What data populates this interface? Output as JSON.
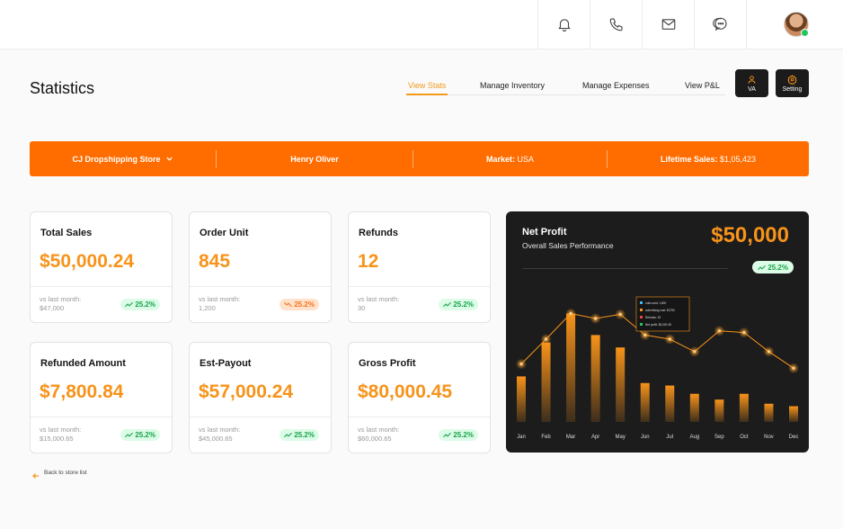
{
  "header": {
    "icons": [
      "bell-icon",
      "phone-icon",
      "mail-icon",
      "chat-icon"
    ]
  },
  "page": {
    "title": "Statistics"
  },
  "nav": {
    "view_stats": "View Stats",
    "manage_inventory": "Manage Inventory",
    "manage_expenses": "Manage Expenses",
    "view_pl": "View P&L",
    "va_label": "VA",
    "setting_label": "Setting",
    "active": "View Stats"
  },
  "banner": {
    "store": "CJ Dropshipping Store",
    "owner": "Henry Oliver",
    "market_label": "Market:",
    "market_value": "USA",
    "lifetime_label": "Lifetime Sales:",
    "lifetime_value": "$1,05,423",
    "color": "#ff6d00"
  },
  "cards": [
    {
      "title": "Total Sales",
      "value": "$50,000.24",
      "foot_l1": "vs last month:",
      "foot_l2": "$47,000",
      "badge": "25.2%",
      "trend": "up"
    },
    {
      "title": "Order Unit",
      "value": "845",
      "foot_l1": "vs last month:",
      "foot_l2": "1,200",
      "badge": "25.2%",
      "trend": "down"
    },
    {
      "title": "Refunds",
      "value": "12",
      "foot_l1": "vs last month:",
      "foot_l2": "30",
      "badge": "25.2%",
      "trend": "up"
    },
    {
      "title": "Refunded Amount",
      "value": "$7,800.84",
      "foot_l1": "vs last month:",
      "foot_l2": "$15,000.65",
      "badge": "25.2%",
      "trend": "up"
    },
    {
      "title": "Est-Payout",
      "value": "$57,000.24",
      "foot_l1": "vs last month:",
      "foot_l2": "$45,000.65",
      "badge": "25.2%",
      "trend": "up"
    },
    {
      "title": "Gross Profit",
      "value": "$80,000.45",
      "foot_l1": "vs last month:",
      "foot_l2": "$60,000.65",
      "badge": "25.2%",
      "trend": "up"
    }
  ],
  "net_profit": {
    "title": "Net Profit",
    "subtitle": "Overall Sales Performance",
    "value": "$50,000",
    "badge": "25.2%",
    "tooltip": [
      "units sold: 1,800",
      "advertising cost: $2750",
      "Refunds: 15",
      "Net profit: $3,000.45"
    ]
  },
  "chart_data": {
    "type": "bar",
    "categories": [
      "Jan",
      "Feb",
      "Mar",
      "Apr",
      "May",
      "Jun",
      "Jul",
      "Aug",
      "Sep",
      "Oct",
      "Nov",
      "Dec"
    ],
    "series": [
      {
        "values": [
          55,
          96,
          131,
          105,
          90,
          47,
          44,
          34,
          27,
          34,
          22,
          19
        ]
      },
      {
        "values": [
          70,
          100,
          131,
          125,
          130,
          105,
          100,
          85,
          110,
          108,
          85,
          65
        ]
      }
    ],
    "ylim": [
      0,
      150
    ],
    "accent": "#f7931a"
  },
  "footer": {
    "back_label": "Back to store list"
  }
}
